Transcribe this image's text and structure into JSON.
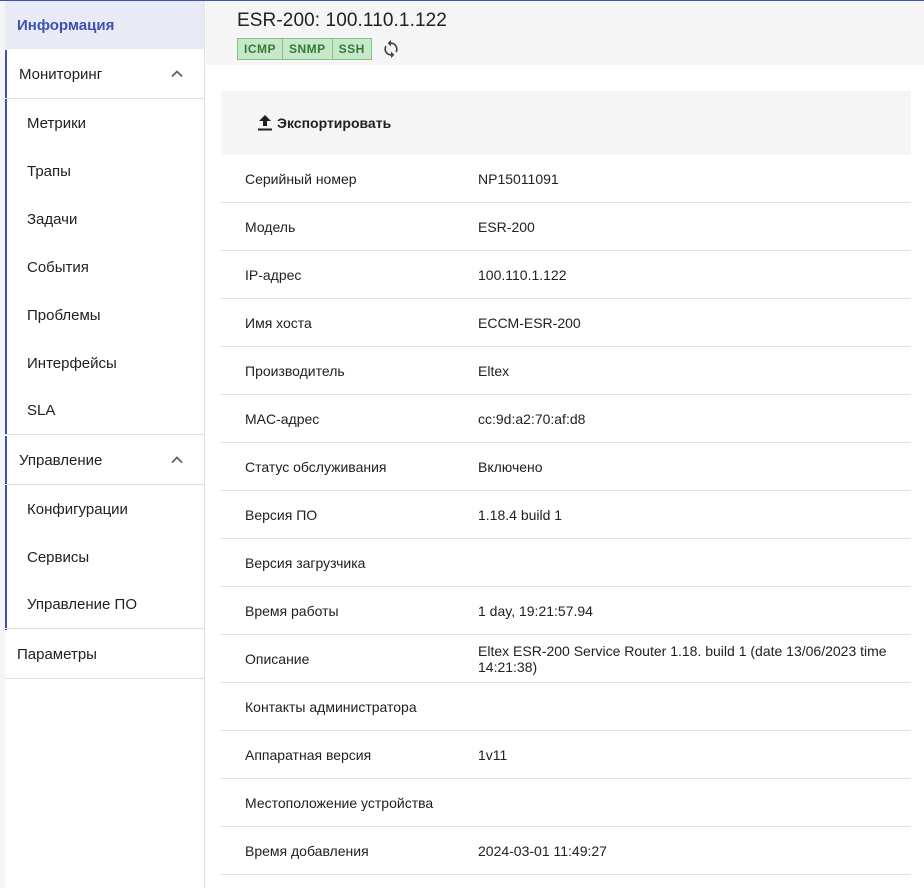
{
  "sidebar": {
    "info": "Информация",
    "monitoring": {
      "label": "Мониторинг",
      "items": [
        "Метрики",
        "Трапы",
        "Задачи",
        "События",
        "Проблемы",
        "Интерфейсы",
        "SLA"
      ]
    },
    "management": {
      "label": "Управление",
      "items": [
        "Конфигурации",
        "Сервисы",
        "Управление ПО"
      ]
    },
    "params": "Параметры"
  },
  "header": {
    "title": "ESR-200: 100.110.1.122",
    "badges": [
      "ICMP",
      "SNMP",
      "SSH"
    ],
    "refresh_icon": "refresh-icon"
  },
  "toolbar": {
    "export_label": "Экспортировать",
    "export_icon": "upload-icon"
  },
  "details": [
    {
      "key": "Серийный номер",
      "value": "NP15011091"
    },
    {
      "key": "Модель",
      "value": "ESR-200"
    },
    {
      "key": "IP-адрес",
      "value": "100.110.1.122"
    },
    {
      "key": "Имя хоста",
      "value": "ECCM-ESR-200"
    },
    {
      "key": "Производитель",
      "value": "Eltex"
    },
    {
      "key": "MAC-адрес",
      "value": "cc:9d:a2:70:af:d8"
    },
    {
      "key": "Статус обслуживания",
      "value": "Включено"
    },
    {
      "key": "Версия ПО",
      "value": "1.18.4 build 1"
    },
    {
      "key": "Версия загрузчика",
      "value": ""
    },
    {
      "key": "Время работы",
      "value": "1 day, 19:21:57.94"
    },
    {
      "key": "Описание",
      "value": "Eltex ESR-200 Service Router 1.18. build 1 (date 13/06/2023 time 14:21:38)"
    },
    {
      "key": "Контакты администратора",
      "value": ""
    },
    {
      "key": "Аппаратная версия",
      "value": "1v11"
    },
    {
      "key": "Местоположение устройства",
      "value": ""
    },
    {
      "key": "Время добавления",
      "value": "2024-03-01 11:49:27"
    }
  ],
  "colors": {
    "accent": "#3f51b5",
    "active_bg": "#e8eaf6",
    "badge_bg": "#c8e6c9",
    "badge_text": "#2e7d32"
  }
}
